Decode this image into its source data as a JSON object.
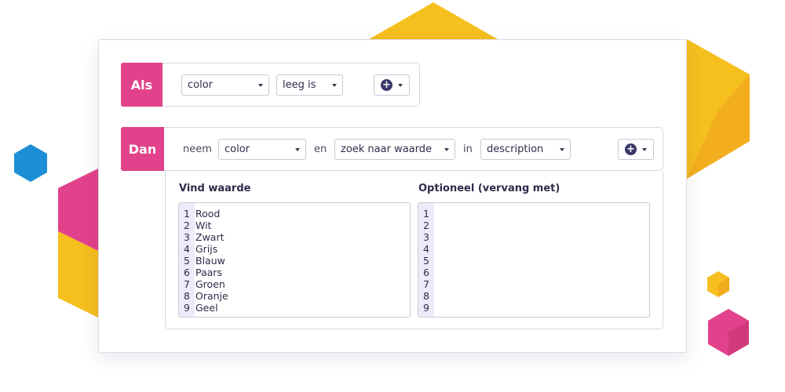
{
  "colors": {
    "accent_pink": "#e2428b",
    "accent_yellow": "#f5bf1e",
    "accent_orange": "#f0a020",
    "accent_blue": "#1c8fd6",
    "button_navy": "#3a3769",
    "gutter": "#ececf9"
  },
  "if_rule": {
    "tag": "Als",
    "field_select": "color",
    "condition_select": "leeg is",
    "add_icon": "plus-circle-icon"
  },
  "then_rule": {
    "tag": "Dan",
    "word_take": "neem",
    "field_select": "color",
    "word_and": "en",
    "action_select": "zoek naar waarde",
    "word_in": "in",
    "target_select": "description",
    "add_icon": "plus-circle-icon"
  },
  "find_replace": {
    "find_title": "Vind waarde",
    "replace_title": "Optioneel (vervang met)",
    "find_lines": [
      {
        "n": "1",
        "text": "Rood"
      },
      {
        "n": "2",
        "text": "Wit"
      },
      {
        "n": "3",
        "text": "Zwart"
      },
      {
        "n": "4",
        "text": "Grijs"
      },
      {
        "n": "5",
        "text": "Blauw"
      },
      {
        "n": "6",
        "text": "Paars"
      },
      {
        "n": "7",
        "text": "Groen"
      },
      {
        "n": "8",
        "text": "Oranje"
      },
      {
        "n": "9",
        "text": "Geel"
      }
    ],
    "replace_lines": [
      {
        "n": "1",
        "text": ""
      },
      {
        "n": "2",
        "text": ""
      },
      {
        "n": "3",
        "text": ""
      },
      {
        "n": "4",
        "text": ""
      },
      {
        "n": "5",
        "text": ""
      },
      {
        "n": "6",
        "text": ""
      },
      {
        "n": "7",
        "text": ""
      },
      {
        "n": "8",
        "text": ""
      },
      {
        "n": "9",
        "text": ""
      }
    ]
  }
}
